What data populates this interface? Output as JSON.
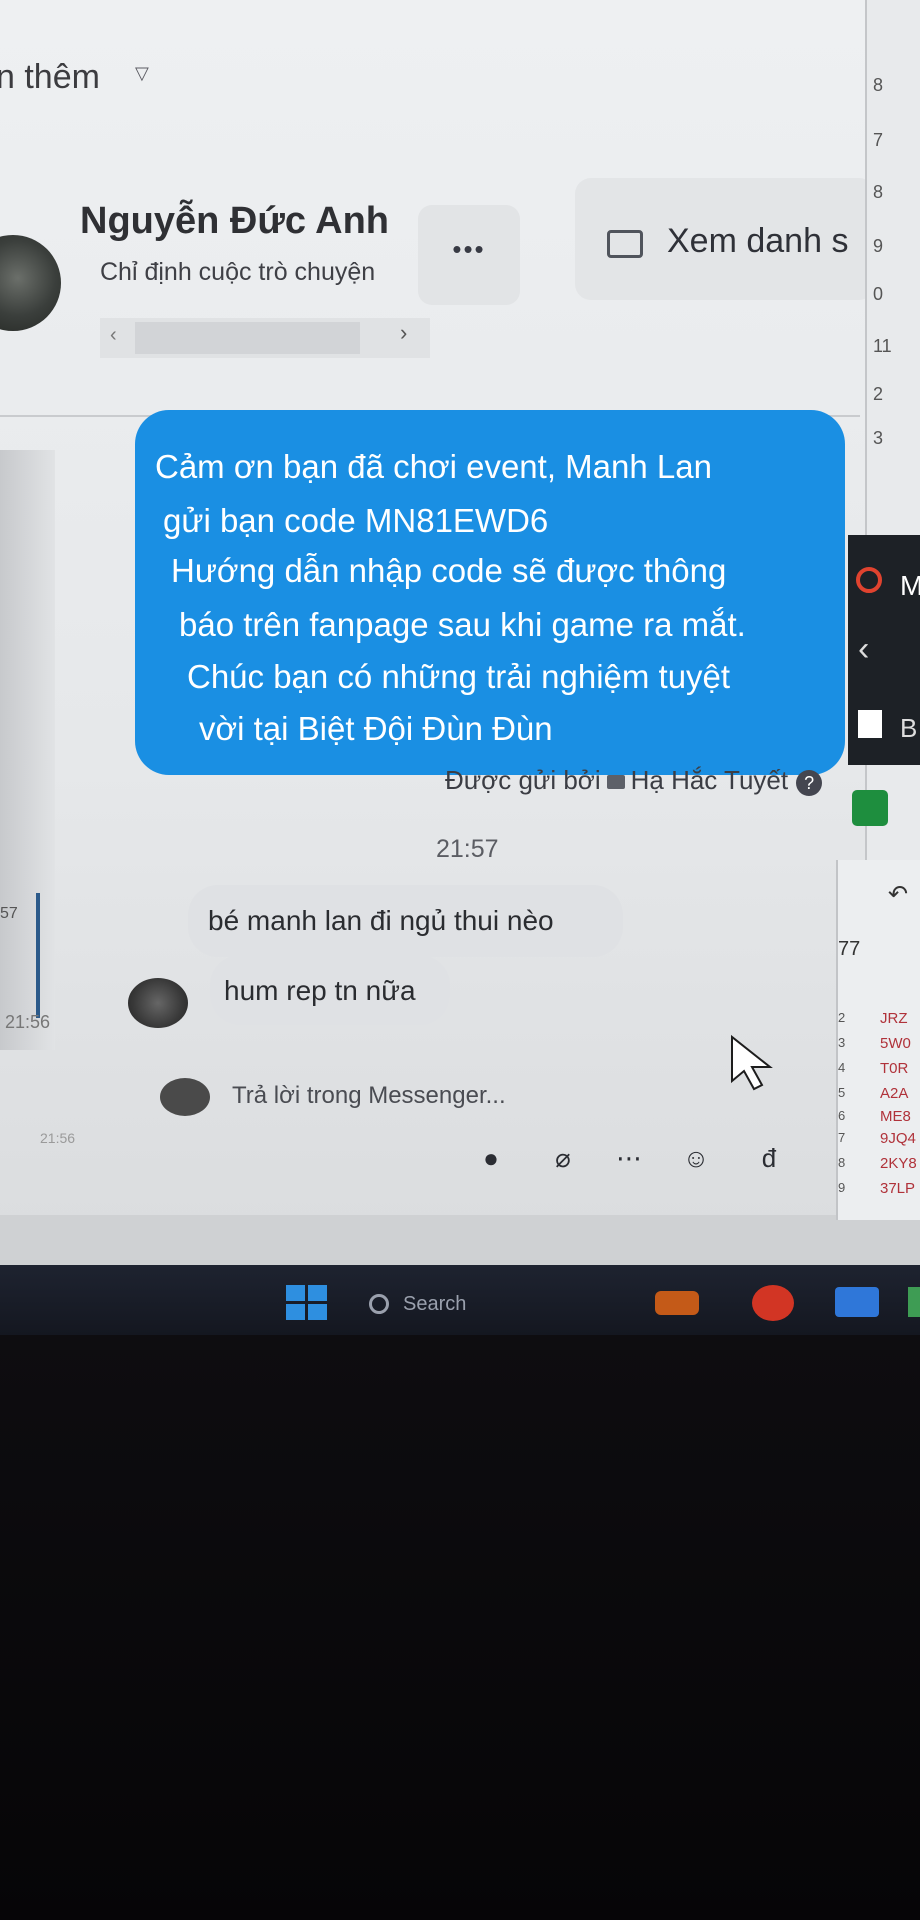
{
  "header": {
    "partial_label": "n thêm",
    "contact_name": "Nguyễn Đức Anh",
    "assign_conversation": "Chỉ định cuộc trò chuyện",
    "more_button": "•••",
    "view_list_button": "Xem danh s"
  },
  "conversation": {
    "sent_message_lines": [
      "Cảm ơn bạn đã chơi event, Manh Lan",
      "gửi bạn code MN81EWD6",
      "Hướng dẫn nhập code sẽ được thông",
      "báo trên fanpage sau khi game ra mắt.",
      "Chúc bạn có những trải nghiệm tuyệt",
      "vời tại Biệt Đội Đùn Đùn"
    ],
    "sent_by_prefix": "Được gửi bởi",
    "sent_by_name": "Hạ Hắc Tuyết",
    "timestamp": "21:57",
    "received_messages": [
      "bé manh lan đi ngủ thui nèo",
      "hum rep tn nữa"
    ],
    "left_times": [
      "57",
      "21:56",
      "21:56"
    ]
  },
  "composer": {
    "placeholder": "Trả lời trong Messenger...",
    "currency_icon": "đ"
  },
  "side_window": {
    "row_numbers": [
      "8",
      "7",
      "8",
      "9",
      "0",
      "11",
      "2",
      "3"
    ],
    "panel_letter_m": "M",
    "panel_letter_b": "B",
    "cell_value": "77",
    "code_rows": [
      {
        "num": "2",
        "val": "JRZ"
      },
      {
        "num": "3",
        "val": "5W0"
      },
      {
        "num": "4",
        "val": "T0R"
      },
      {
        "num": "5",
        "val": "A2A"
      },
      {
        "num": "6",
        "val": "ME8"
      },
      {
        "num": "7",
        "val": "9JQ4"
      },
      {
        "num": "8",
        "val": "2KY8"
      },
      {
        "num": "9",
        "val": "37LP"
      }
    ]
  },
  "taskbar": {
    "search_label": "Search"
  },
  "colors": {
    "accent": "#1a8fe3",
    "received_bubble": "#dfe1e4"
  }
}
